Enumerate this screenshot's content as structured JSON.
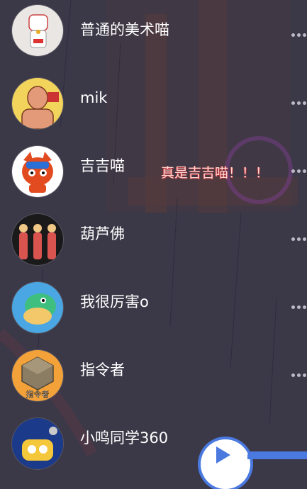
{
  "contacts": [
    {
      "name": "普通的美术喵",
      "avatar_icon": "lucky-cat-avatar-icon",
      "avatar_color": "#e9e6e3"
    },
    {
      "name": "mik",
      "avatar_icon": "muscle-man-avatar-icon",
      "avatar_color": "#f2d35b"
    },
    {
      "name": "吉吉喵",
      "avatar_icon": "cartoon-cat-avatar-icon",
      "avatar_color": "#ffffff"
    },
    {
      "name": "葫芦佛",
      "avatar_icon": "three-buddhas-avatar-icon",
      "avatar_color": "#1a1a1a"
    },
    {
      "name": "我很厉害o",
      "avatar_icon": "green-dinosaur-avatar-icon",
      "avatar_color": "#4aa7e3"
    },
    {
      "name": "指令者",
      "avatar_icon": "minecraft-block-avatar-icon",
      "avatar_color": "#f3a23a",
      "avatar_text": "指令者"
    },
    {
      "name": "小鸣同学360",
      "avatar_icon": "robot-avatar-icon",
      "avatar_color": "#1b3a8a"
    }
  ],
  "status_text": "真是吉吉喵！！！",
  "more_icon": "more-dots-icon",
  "colors": {
    "background": "#3b3847",
    "accent": "#4a79e0",
    "text": "#ffffff"
  }
}
